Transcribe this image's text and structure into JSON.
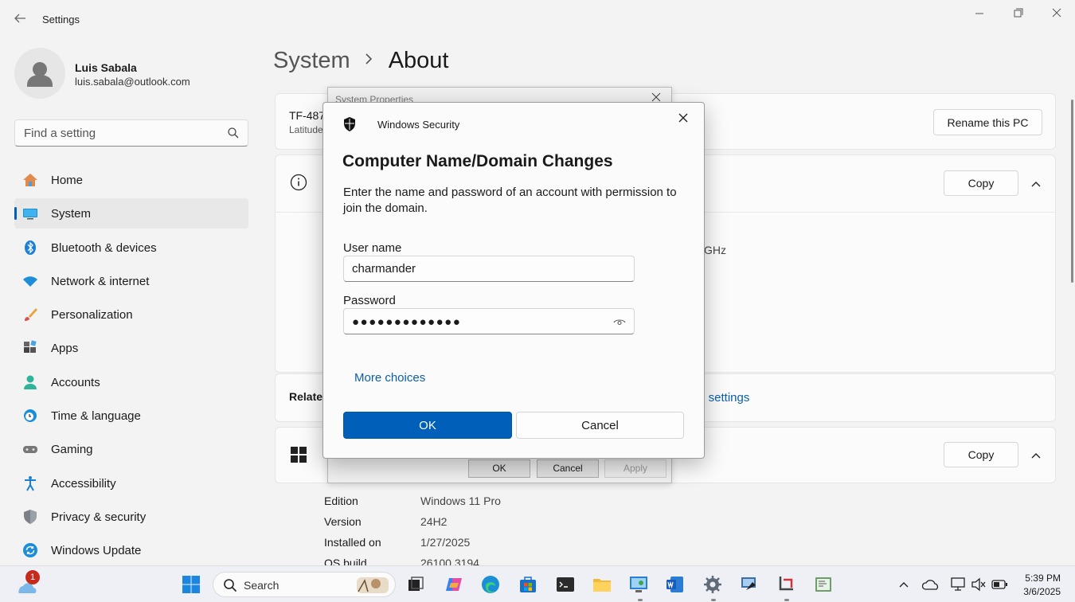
{
  "window": {
    "title": "Settings"
  },
  "profile": {
    "name": "Luis Sabala",
    "email": "luis.sabala@outlook.com"
  },
  "search": {
    "placeholder": "Find a setting"
  },
  "nav": {
    "items": [
      {
        "label": "Home",
        "icon": "home-icon"
      },
      {
        "label": "System",
        "icon": "system-icon",
        "selected": true
      },
      {
        "label": "Bluetooth & devices",
        "icon": "bluetooth-icon"
      },
      {
        "label": "Network & internet",
        "icon": "wifi-icon"
      },
      {
        "label": "Personalization",
        "icon": "brush-icon"
      },
      {
        "label": "Apps",
        "icon": "apps-icon"
      },
      {
        "label": "Accounts",
        "icon": "person-icon"
      },
      {
        "label": "Time & language",
        "icon": "clock-globe-icon"
      },
      {
        "label": "Gaming",
        "icon": "gamepad-icon"
      },
      {
        "label": "Accessibility",
        "icon": "accessibility-icon"
      },
      {
        "label": "Privacy & security",
        "icon": "shield-icon"
      },
      {
        "label": "Windows Update",
        "icon": "update-icon"
      }
    ]
  },
  "breadcrumb": {
    "parent": "System",
    "current": "About"
  },
  "pc": {
    "name_fragment": "TF-487",
    "model_fragment": "Latitude",
    "rename_label": "Rename this PC"
  },
  "device_specs": {
    "copy_label": "Copy",
    "frag_ghz": "GHz"
  },
  "related": {
    "label_fragment": "Relate",
    "link_fragment": "m settings"
  },
  "windows_specs": {
    "copy_label": "Copy",
    "rows": [
      {
        "label": "Edition",
        "value": "Windows 11 Pro"
      },
      {
        "label": "Version",
        "value": "24H2"
      },
      {
        "label": "Installed on",
        "value": "1/27/2025"
      },
      {
        "label": "OS build",
        "value": "26100.3194"
      }
    ]
  },
  "system_properties": {
    "title": "System Properties",
    "ok": "OK",
    "cancel": "Cancel",
    "apply": "Apply"
  },
  "security_dialog": {
    "app_name": "Windows Security",
    "heading": "Computer Name/Domain Changes",
    "description": "Enter the name and password of an account with permission to join the domain.",
    "username_label": "User name",
    "username_value": "charmander",
    "password_label": "Password",
    "password_masked": "●●●●●●●●●●●●●",
    "more_choices": "More choices",
    "ok": "OK",
    "cancel": "Cancel"
  },
  "taskbar": {
    "search_label": "Search",
    "notification_badge": "1",
    "time": "5:39 PM",
    "date": "3/6/2025"
  },
  "colors": {
    "accent": "#005fb8",
    "link": "#0a5ea8",
    "badge": "#c42b1c"
  }
}
